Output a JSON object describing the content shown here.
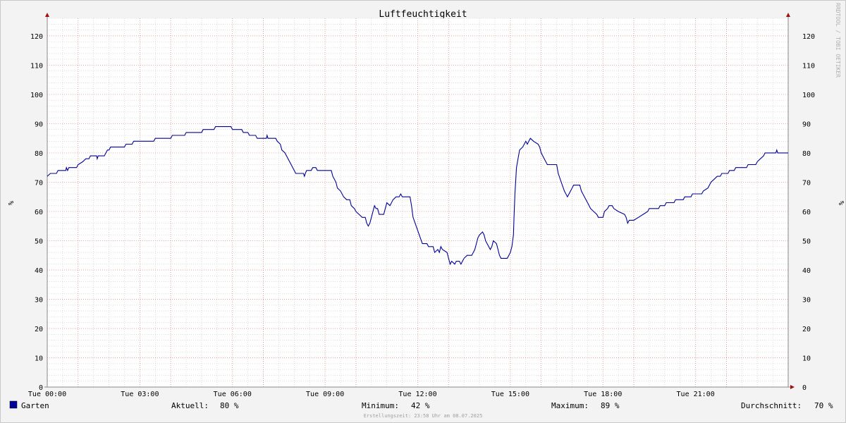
{
  "chart_data": {
    "type": "line",
    "title": "Luftfeuchtigkeit",
    "ylabel": "%",
    "ylim": [
      0,
      126
    ],
    "yticks": [
      0,
      10,
      20,
      30,
      40,
      50,
      60,
      70,
      80,
      90,
      100,
      110,
      120
    ],
    "xlabels": [
      "Tue 00:00",
      "Tue 03:00",
      "Tue 06:00",
      "Tue 09:00",
      "Tue 12:00",
      "Tue 15:00",
      "Tue 18:00",
      "Tue 21:00"
    ],
    "x_hours_range": [
      0,
      24
    ],
    "grid": true,
    "watermark": "RRDTOOL / TOBI OETIKER",
    "series": [
      {
        "name": "Garten",
        "color": "#000099",
        "points": [
          [
            0.0,
            72
          ],
          [
            0.1,
            73
          ],
          [
            0.3,
            73
          ],
          [
            0.35,
            74
          ],
          [
            0.6,
            74
          ],
          [
            0.62,
            75
          ],
          [
            0.66,
            74
          ],
          [
            0.7,
            75
          ],
          [
            0.95,
            75
          ],
          [
            1.0,
            76
          ],
          [
            1.15,
            77
          ],
          [
            1.25,
            78
          ],
          [
            1.35,
            78
          ],
          [
            1.4,
            79
          ],
          [
            1.6,
            79
          ],
          [
            1.62,
            78
          ],
          [
            1.65,
            79
          ],
          [
            1.85,
            79
          ],
          [
            1.9,
            80
          ],
          [
            1.95,
            81
          ],
          [
            2.0,
            81
          ],
          [
            2.05,
            82
          ],
          [
            2.5,
            82
          ],
          [
            2.55,
            83
          ],
          [
            2.75,
            83
          ],
          [
            2.8,
            84
          ],
          [
            3.45,
            84
          ],
          [
            3.5,
            85
          ],
          [
            4.0,
            85
          ],
          [
            4.05,
            86
          ],
          [
            4.45,
            86
          ],
          [
            4.5,
            87
          ],
          [
            5.0,
            87
          ],
          [
            5.05,
            88
          ],
          [
            5.4,
            88
          ],
          [
            5.45,
            89
          ],
          [
            5.95,
            89
          ],
          [
            6.0,
            88
          ],
          [
            6.3,
            88
          ],
          [
            6.35,
            87
          ],
          [
            6.5,
            87
          ],
          [
            6.55,
            86
          ],
          [
            6.75,
            86
          ],
          [
            6.8,
            85
          ],
          [
            7.1,
            85
          ],
          [
            7.12,
            86
          ],
          [
            7.15,
            85
          ],
          [
            7.4,
            85
          ],
          [
            7.45,
            84
          ],
          [
            7.55,
            83
          ],
          [
            7.6,
            81
          ],
          [
            7.7,
            80
          ],
          [
            7.75,
            79
          ],
          [
            7.85,
            77
          ],
          [
            7.9,
            76
          ],
          [
            8.0,
            74
          ],
          [
            8.05,
            73
          ],
          [
            8.3,
            73
          ],
          [
            8.33,
            72
          ],
          [
            8.36,
            73
          ],
          [
            8.4,
            74
          ],
          [
            8.55,
            74
          ],
          [
            8.6,
            75
          ],
          [
            8.7,
            75
          ],
          [
            8.75,
            74
          ],
          [
            9.2,
            74
          ],
          [
            9.25,
            72
          ],
          [
            9.35,
            70
          ],
          [
            9.4,
            68
          ],
          [
            9.5,
            67
          ],
          [
            9.6,
            65
          ],
          [
            9.7,
            64
          ],
          [
            9.8,
            64
          ],
          [
            9.85,
            62
          ],
          [
            9.95,
            61
          ],
          [
            10.0,
            60
          ],
          [
            10.1,
            59
          ],
          [
            10.2,
            58
          ],
          [
            10.3,
            58
          ],
          [
            10.35,
            56
          ],
          [
            10.4,
            55
          ],
          [
            10.45,
            56
          ],
          [
            10.5,
            58
          ],
          [
            10.55,
            60
          ],
          [
            10.6,
            62
          ],
          [
            10.65,
            61
          ],
          [
            10.7,
            61
          ],
          [
            10.75,
            59
          ],
          [
            10.9,
            59
          ],
          [
            10.95,
            61
          ],
          [
            11.0,
            63
          ],
          [
            11.1,
            62
          ],
          [
            11.2,
            64
          ],
          [
            11.3,
            65
          ],
          [
            11.4,
            65
          ],
          [
            11.45,
            66
          ],
          [
            11.5,
            65
          ],
          [
            11.75,
            65
          ],
          [
            11.8,
            62
          ],
          [
            11.85,
            58
          ],
          [
            11.95,
            55
          ],
          [
            12.05,
            52
          ],
          [
            12.15,
            49
          ],
          [
            12.3,
            49
          ],
          [
            12.35,
            48
          ],
          [
            12.5,
            48
          ],
          [
            12.55,
            46
          ],
          [
            12.65,
            47
          ],
          [
            12.7,
            46
          ],
          [
            12.75,
            48
          ],
          [
            12.8,
            47
          ],
          [
            12.95,
            46
          ],
          [
            13.0,
            44
          ],
          [
            13.05,
            42
          ],
          [
            13.1,
            43
          ],
          [
            13.2,
            42
          ],
          [
            13.25,
            43
          ],
          [
            13.35,
            43
          ],
          [
            13.4,
            42
          ],
          [
            13.45,
            43
          ],
          [
            13.5,
            44
          ],
          [
            13.6,
            45
          ],
          [
            13.75,
            45
          ],
          [
            13.8,
            46
          ],
          [
            13.85,
            47
          ],
          [
            13.9,
            49
          ],
          [
            13.95,
            51
          ],
          [
            14.0,
            52
          ],
          [
            14.1,
            53
          ],
          [
            14.15,
            52
          ],
          [
            14.2,
            50
          ],
          [
            14.3,
            48
          ],
          [
            14.35,
            47
          ],
          [
            14.4,
            48
          ],
          [
            14.45,
            50
          ],
          [
            14.55,
            49
          ],
          [
            14.6,
            47
          ],
          [
            14.65,
            45
          ],
          [
            14.7,
            44
          ],
          [
            14.9,
            44
          ],
          [
            14.95,
            45
          ],
          [
            15.0,
            46
          ],
          [
            15.05,
            48
          ],
          [
            15.1,
            52
          ],
          [
            15.12,
            58
          ],
          [
            15.15,
            66
          ],
          [
            15.2,
            75
          ],
          [
            15.25,
            78
          ],
          [
            15.3,
            81
          ],
          [
            15.4,
            82
          ],
          [
            15.45,
            83
          ],
          [
            15.5,
            84
          ],
          [
            15.55,
            83
          ],
          [
            15.6,
            84
          ],
          [
            15.65,
            85
          ],
          [
            15.75,
            84
          ],
          [
            15.9,
            83
          ],
          [
            15.95,
            82
          ],
          [
            16.0,
            80
          ],
          [
            16.1,
            78
          ],
          [
            16.2,
            76
          ],
          [
            16.3,
            76
          ],
          [
            16.35,
            76
          ],
          [
            16.5,
            76
          ],
          [
            16.55,
            73
          ],
          [
            16.65,
            70
          ],
          [
            16.75,
            67
          ],
          [
            16.85,
            65
          ],
          [
            16.9,
            66
          ],
          [
            17.0,
            68
          ],
          [
            17.05,
            69
          ],
          [
            17.25,
            69
          ],
          [
            17.3,
            67
          ],
          [
            17.4,
            65
          ],
          [
            17.5,
            63
          ],
          [
            17.6,
            61
          ],
          [
            17.7,
            60
          ],
          [
            17.8,
            59
          ],
          [
            17.85,
            58
          ],
          [
            18.0,
            58
          ],
          [
            18.05,
            60
          ],
          [
            18.15,
            61
          ],
          [
            18.2,
            62
          ],
          [
            18.3,
            62
          ],
          [
            18.35,
            61
          ],
          [
            18.5,
            60
          ],
          [
            18.7,
            59
          ],
          [
            18.75,
            58
          ],
          [
            18.8,
            56
          ],
          [
            18.85,
            57
          ],
          [
            19.0,
            57
          ],
          [
            19.15,
            58
          ],
          [
            19.3,
            59
          ],
          [
            19.45,
            60
          ],
          [
            19.5,
            61
          ],
          [
            19.8,
            61
          ],
          [
            19.85,
            62
          ],
          [
            20.0,
            62
          ],
          [
            20.05,
            63
          ],
          [
            20.3,
            63
          ],
          [
            20.35,
            64
          ],
          [
            20.6,
            64
          ],
          [
            20.65,
            65
          ],
          [
            20.85,
            65
          ],
          [
            20.9,
            66
          ],
          [
            21.2,
            66
          ],
          [
            21.25,
            67
          ],
          [
            21.4,
            68
          ],
          [
            21.5,
            70
          ],
          [
            21.6,
            71
          ],
          [
            21.7,
            72
          ],
          [
            21.8,
            72
          ],
          [
            21.85,
            73
          ],
          [
            22.05,
            73
          ],
          [
            22.1,
            74
          ],
          [
            22.25,
            74
          ],
          [
            22.3,
            75
          ],
          [
            22.65,
            75
          ],
          [
            22.7,
            76
          ],
          [
            22.95,
            76
          ],
          [
            23.0,
            77
          ],
          [
            23.1,
            78
          ],
          [
            23.2,
            79
          ],
          [
            23.25,
            80
          ],
          [
            23.6,
            80
          ],
          [
            23.63,
            81
          ],
          [
            23.66,
            80
          ],
          [
            24.0,
            80
          ]
        ]
      }
    ]
  },
  "legend": {
    "series_name": "Garten",
    "swatch_color": "#000099",
    "current_label": "Aktuell:",
    "current_value": "80 %",
    "min_label": "Minimum:",
    "min_value": "42 %",
    "max_label": "Maximum:",
    "max_value": "89 %",
    "avg_label": "Durchschnitt:",
    "avg_value": "70 %"
  },
  "footer": {
    "timestamp": "Erstellungszeit: 23:58 Uhr am 08.07.2025"
  },
  "colors": {
    "major_grid": "#e08080",
    "minor_grid": "#c8c8c8",
    "axis": "#a01010",
    "line": "#000099"
  }
}
